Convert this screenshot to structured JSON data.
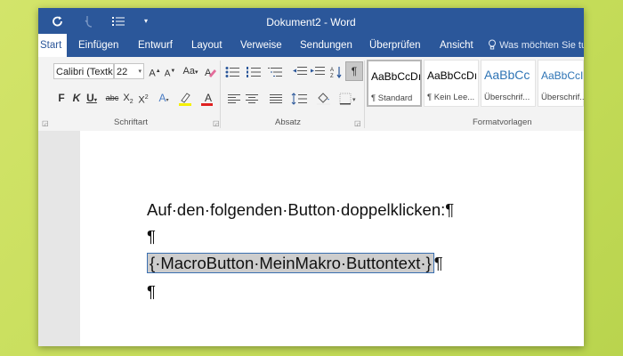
{
  "window": {
    "title": "Dokument2 - Word",
    "qat": {
      "save_icon": "save-icon",
      "redo_icon": "redo-icon",
      "touch_icon": "touch-mode-icon",
      "list_icon": "list-icon",
      "customize_icon": "chevron-down-icon"
    }
  },
  "tabs": [
    {
      "label": "Start"
    },
    {
      "label": "Einfügen"
    },
    {
      "label": "Entwurf"
    },
    {
      "label": "Layout"
    },
    {
      "label": "Verweise"
    },
    {
      "label": "Sendungen"
    },
    {
      "label": "Überprüfen"
    },
    {
      "label": "Ansicht"
    }
  ],
  "tell_me": {
    "placeholder": "Was möchten Sie tu"
  },
  "ribbon": {
    "font": {
      "group_label": "Schriftart",
      "font_name": "Calibri (Textk",
      "font_size": "22",
      "grow": "A",
      "shrink": "A",
      "case": "Aa",
      "bold": "F",
      "italic": "K",
      "underline": "U",
      "strike": "abc",
      "subscript": "X",
      "subscript_sub": "2",
      "superscript": "X",
      "superscript_sup": "2",
      "effects": "A",
      "font_color": "A"
    },
    "paragraph": {
      "group_label": "Absatz",
      "pilcrow": "¶"
    },
    "styles": {
      "group_label": "Formatvorlagen",
      "items": [
        {
          "sample": "AaBbCcDı",
          "name": "¶ Standard",
          "color": "#222222"
        },
        {
          "sample": "AaBbCcDı",
          "name": "¶ Kein Lee...",
          "color": "#222222"
        },
        {
          "sample": "AaBbCc",
          "name": "Überschrif...",
          "color": "#2e74b5"
        },
        {
          "sample": "AaBbCcI",
          "name": "Überschrif...",
          "color": "#2e74b5"
        }
      ]
    }
  },
  "document": {
    "line1": "Auf·den·folgenden·Button·doppelklicken:¶",
    "line2": "¶",
    "field_open": "{",
    "field_text": "·MacroButton·MeinMakro·Buttontext·",
    "field_close": "}",
    "line3_tail": "¶",
    "line4": "¶"
  },
  "colors": {
    "word_blue": "#2b579a",
    "accent_red": "#e02020"
  }
}
